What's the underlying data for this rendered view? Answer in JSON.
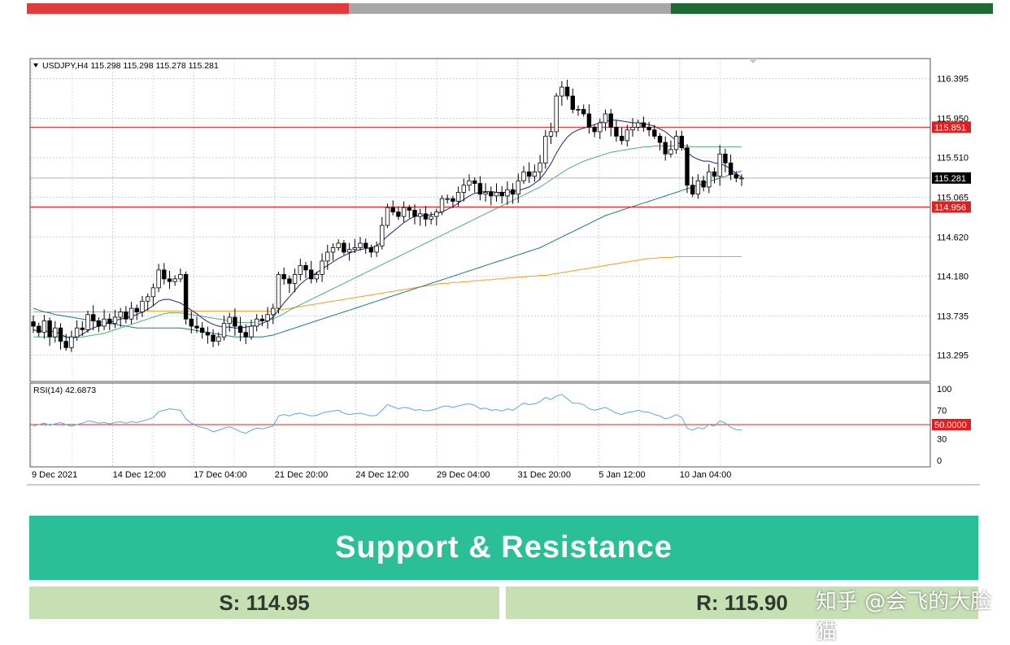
{
  "colors": {
    "bar_red": "#e03c3c",
    "bar_gray": "#a7a7a7",
    "bar_green": "#1d6a33",
    "ma_fast": "#1f1f8f",
    "ma_mid": "#4caf78",
    "ma_slow": "#1a7a8a",
    "ma_long": "#f0a020",
    "rsi_line": "#5aa8e0",
    "level_line": "#e02020",
    "header_bg": "#2abf96",
    "box_bg": "#c6e0b4"
  },
  "chart_data": {
    "type": "candlestick",
    "symbol_header": "USDJPY,H4  115.298 115.298 115.278 115.281",
    "ylim": [
      113.0,
      116.62
    ],
    "y_ticks": [
      "116.395",
      "115.950",
      "115.510",
      "115.065",
      "114.620",
      "114.180",
      "113.735",
      "113.295"
    ],
    "x_tick_labels": [
      "9 Dec 2021",
      "14 Dec 12:00",
      "17 Dec 04:00",
      "21 Dec 20:00",
      "24 Dec 12:00",
      "29 Dec 04:00",
      "31 Dec 20:00",
      "5 Jan 12:00",
      "10 Jan 04:00"
    ],
    "current_price": {
      "value": 115.281,
      "label": "115.281"
    },
    "levels": [
      {
        "value": 115.851,
        "label": "115.851"
      },
      {
        "value": 114.956,
        "label": "114.956"
      }
    ],
    "close": [
      113.62,
      113.55,
      113.68,
      113.5,
      113.6,
      113.45,
      113.38,
      113.5,
      113.6,
      113.58,
      113.75,
      113.68,
      113.62,
      113.7,
      113.65,
      113.72,
      113.78,
      113.7,
      113.82,
      113.78,
      113.9,
      113.95,
      114.05,
      114.25,
      114.15,
      114.12,
      114.15,
      114.2,
      113.7,
      113.62,
      113.6,
      113.55,
      113.52,
      113.45,
      113.5,
      113.65,
      113.72,
      113.62,
      113.55,
      113.5,
      113.62,
      113.7,
      113.68,
      113.75,
      113.82,
      114.2,
      114.15,
      114.1,
      114.2,
      114.3,
      114.25,
      114.15,
      114.2,
      114.35,
      114.45,
      114.5,
      114.55,
      114.45,
      114.48,
      114.5,
      114.55,
      114.5,
      114.45,
      114.52,
      114.75,
      114.95,
      114.9,
      114.85,
      114.95,
      114.92,
      114.85,
      114.88,
      114.82,
      114.85,
      114.9,
      115.05,
      115.05,
      115.02,
      115.12,
      115.2,
      115.25,
      115.22,
      115.1,
      115.12,
      115.08,
      115.12,
      115.08,
      115.15,
      115.1,
      115.25,
      115.35,
      115.3,
      115.35,
      115.45,
      115.75,
      115.8,
      116.2,
      116.3,
      116.2,
      116.05,
      116.05,
      116.0,
      115.85,
      115.8,
      115.9,
      116.0,
      115.85,
      115.75,
      115.7,
      115.82,
      115.85,
      115.9,
      115.85,
      115.82,
      115.75,
      115.68,
      115.55,
      115.6,
      115.75,
      115.62,
      115.2,
      115.1,
      115.25,
      115.18,
      115.35,
      115.3,
      115.55,
      115.45,
      115.32,
      115.28,
      115.281
    ],
    "ma_fast": [
      113.58,
      113.56,
      113.57,
      113.56,
      113.56,
      113.53,
      113.5,
      113.48,
      113.5,
      113.53,
      113.57,
      113.6,
      113.62,
      113.64,
      113.66,
      113.68,
      113.7,
      113.71,
      113.73,
      113.75,
      113.78,
      113.81,
      113.85,
      113.9,
      113.92,
      113.92,
      113.9,
      113.88,
      113.84,
      113.8,
      113.76,
      113.71,
      113.67,
      113.64,
      113.62,
      113.61,
      113.61,
      113.6,
      113.6,
      113.61,
      113.62,
      113.63,
      113.65,
      113.68,
      113.72,
      113.8,
      113.88,
      113.95,
      114.02,
      114.09,
      114.14,
      114.18,
      114.22,
      114.26,
      114.3,
      114.34,
      114.38,
      114.41,
      114.44,
      114.46,
      114.48,
      114.49,
      114.5,
      114.52,
      114.57,
      114.63,
      114.68,
      114.73,
      114.78,
      114.82,
      114.85,
      114.86,
      114.86,
      114.87,
      114.88,
      114.9,
      114.93,
      114.96,
      115.0,
      115.04,
      115.08,
      115.11,
      115.12,
      115.13,
      115.13,
      115.12,
      115.12,
      115.12,
      115.13,
      115.14,
      115.16,
      115.18,
      115.22,
      115.27,
      115.35,
      115.44,
      115.56,
      115.66,
      115.74,
      115.79,
      115.82,
      115.84,
      115.86,
      115.88,
      115.9,
      115.92,
      115.93,
      115.93,
      115.92,
      115.91,
      115.9,
      115.9,
      115.89,
      115.88,
      115.86,
      115.83,
      115.8,
      115.75,
      115.7,
      115.64,
      115.57,
      115.52,
      115.49,
      115.47,
      115.47,
      115.45,
      115.44,
      115.42,
      115.38,
      115.33,
      115.29
    ],
    "ma_mid": [
      113.5,
      113.5,
      113.5,
      113.5,
      113.5,
      113.5,
      113.5,
      113.5,
      113.5,
      113.5,
      113.51,
      113.52,
      113.53,
      113.54,
      113.56,
      113.58,
      113.6,
      113.62,
      113.64,
      113.66,
      113.68,
      113.7,
      113.72,
      113.74,
      113.76,
      113.77,
      113.77,
      113.77,
      113.76,
      113.75,
      113.74,
      113.73,
      113.72,
      113.71,
      113.7,
      113.69,
      113.68,
      113.67,
      113.66,
      113.66,
      113.66,
      113.67,
      113.68,
      113.69,
      113.7,
      113.73,
      113.76,
      113.8,
      113.83,
      113.86,
      113.89,
      113.92,
      113.95,
      113.98,
      114.01,
      114.04,
      114.07,
      114.1,
      114.13,
      114.16,
      114.19,
      114.22,
      114.25,
      114.28,
      114.31,
      114.34,
      114.37,
      114.4,
      114.43,
      114.46,
      114.49,
      114.52,
      114.55,
      114.58,
      114.61,
      114.64,
      114.67,
      114.7,
      114.73,
      114.76,
      114.79,
      114.82,
      114.85,
      114.88,
      114.91,
      114.94,
      114.97,
      115.0,
      115.03,
      115.06,
      115.09,
      115.12,
      115.15,
      115.18,
      115.22,
      115.26,
      115.3,
      115.34,
      115.38,
      115.41,
      115.44,
      115.47,
      115.49,
      115.51,
      115.53,
      115.55,
      115.57,
      115.58,
      115.59,
      115.6,
      115.61,
      115.62,
      115.63,
      115.63,
      115.64,
      115.64,
      115.64,
      115.64,
      115.64,
      115.64,
      115.64,
      115.63,
      115.63,
      115.63,
      115.63,
      115.63,
      115.63,
      115.63,
      115.63,
      115.63,
      115.63
    ],
    "ma_slow": [
      113.82,
      113.8,
      113.78,
      113.77,
      113.75,
      113.74,
      113.73,
      113.72,
      113.71,
      113.7,
      113.69,
      113.68,
      113.67,
      113.66,
      113.65,
      113.64,
      113.63,
      113.62,
      113.61,
      113.6,
      113.6,
      113.6,
      113.6,
      113.6,
      113.6,
      113.6,
      113.6,
      113.6,
      113.59,
      113.58,
      113.57,
      113.56,
      113.55,
      113.54,
      113.53,
      113.52,
      113.51,
      113.5,
      113.5,
      113.5,
      113.5,
      113.5,
      113.5,
      113.51,
      113.52,
      113.54,
      113.56,
      113.58,
      113.6,
      113.62,
      113.64,
      113.66,
      113.68,
      113.7,
      113.72,
      113.74,
      113.76,
      113.78,
      113.8,
      113.82,
      113.84,
      113.86,
      113.88,
      113.9,
      113.92,
      113.94,
      113.96,
      113.98,
      114.0,
      114.02,
      114.04,
      114.06,
      114.08,
      114.1,
      114.12,
      114.14,
      114.16,
      114.18,
      114.2,
      114.22,
      114.24,
      114.26,
      114.28,
      114.3,
      114.32,
      114.34,
      114.36,
      114.38,
      114.4,
      114.42,
      114.44,
      114.46,
      114.48,
      114.5,
      114.53,
      114.56,
      114.59,
      114.62,
      114.65,
      114.68,
      114.71,
      114.74,
      114.77,
      114.8,
      114.83,
      114.86,
      114.88,
      114.9,
      114.92,
      114.94,
      114.96,
      114.98,
      115.0,
      115.02,
      115.04,
      115.06,
      115.08,
      115.1,
      115.12,
      115.14,
      115.16,
      115.18,
      115.2,
      115.22,
      115.24,
      115.26,
      115.28,
      115.3,
      115.32,
      115.34,
      115.36
    ],
    "ma_long": [
      113.78,
      113.78,
      113.78,
      113.78,
      113.78,
      113.78,
      113.78,
      113.78,
      113.78,
      113.78,
      113.78,
      113.78,
      113.78,
      113.78,
      113.78,
      113.78,
      113.78,
      113.78,
      113.78,
      113.78,
      113.79,
      113.79,
      113.79,
      113.79,
      113.79,
      113.79,
      113.79,
      113.79,
      113.79,
      113.79,
      113.79,
      113.79,
      113.79,
      113.79,
      113.79,
      113.79,
      113.79,
      113.79,
      113.79,
      113.79,
      113.79,
      113.79,
      113.79,
      113.79,
      113.79,
      113.8,
      113.81,
      113.82,
      113.83,
      113.84,
      113.85,
      113.86,
      113.87,
      113.88,
      113.89,
      113.9,
      113.91,
      113.92,
      113.93,
      113.94,
      113.95,
      113.96,
      113.97,
      113.98,
      113.99,
      114.0,
      114.01,
      114.02,
      114.03,
      114.04,
      114.05,
      114.06,
      114.07,
      114.08,
      114.09,
      114.1,
      114.1,
      114.11,
      114.11,
      114.12,
      114.12,
      114.13,
      114.13,
      114.14,
      114.14,
      114.15,
      114.15,
      114.16,
      114.16,
      114.17,
      114.17,
      114.18,
      114.18,
      114.19,
      114.19,
      114.2,
      114.21,
      114.22,
      114.23,
      114.24,
      114.25,
      114.26,
      114.27,
      114.28,
      114.29,
      114.3,
      114.31,
      114.32,
      114.33,
      114.34,
      114.35,
      114.36,
      114.37,
      114.38,
      114.38,
      114.39,
      114.39,
      114.39,
      114.4,
      114.4,
      114.4,
      114.4,
      114.4,
      114.4,
      114.4,
      114.4,
      114.4,
      114.4,
      114.4,
      114.4,
      114.4
    ],
    "rsi": {
      "header": "RSI(14) 42.6873",
      "ylim": [
        0,
        100
      ],
      "y_ticks": [
        "100",
        "70",
        "30",
        "0"
      ],
      "level": {
        "value": 50,
        "label": "50.0000"
      },
      "values": [
        48,
        50,
        52,
        49,
        51,
        53,
        50,
        48,
        50,
        52,
        55,
        54,
        52,
        53,
        51,
        53,
        54,
        52,
        54,
        53,
        55,
        57,
        60,
        68,
        70,
        72,
        71,
        70,
        58,
        52,
        48,
        46,
        44,
        40,
        42,
        45,
        47,
        44,
        40,
        38,
        42,
        45,
        44,
        46,
        48,
        62,
        64,
        62,
        65,
        66,
        64,
        62,
        63,
        66,
        68,
        69,
        70,
        66,
        64,
        65,
        66,
        64,
        62,
        63,
        70,
        78,
        75,
        72,
        74,
        73,
        70,
        71,
        69,
        70,
        72,
        75,
        76,
        74,
        76,
        78,
        79,
        77,
        72,
        73,
        70,
        71,
        69,
        72,
        70,
        75,
        80,
        78,
        79,
        82,
        88,
        85,
        90,
        92,
        86,
        80,
        80,
        78,
        72,
        70,
        72,
        74,
        70,
        66,
        64,
        67,
        68,
        70,
        68,
        67,
        64,
        62,
        58,
        60,
        64,
        60,
        45,
        42,
        46,
        44,
        50,
        48,
        55,
        52,
        46,
        43,
        42.7
      ]
    }
  },
  "sr": {
    "title": "Support & Resistance",
    "support": "S: 114.95",
    "resistance": "R: 115.90"
  },
  "watermark": "知乎 @会飞的大脸猫"
}
